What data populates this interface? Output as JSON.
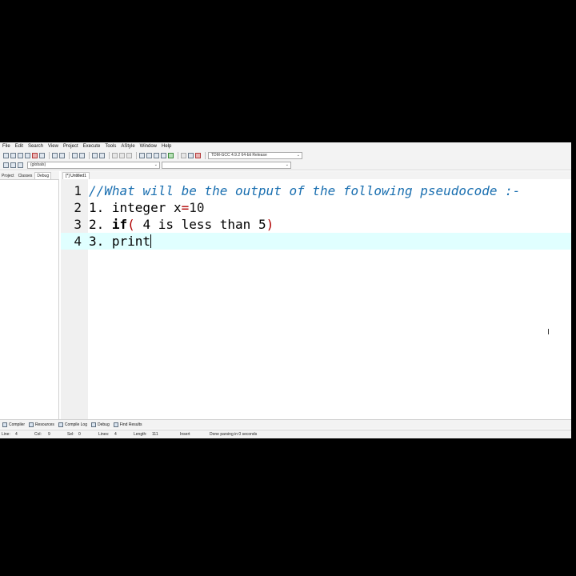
{
  "menu": [
    "File",
    "Edit",
    "Search",
    "View",
    "Project",
    "Execute",
    "Tools",
    "AStyle",
    "Window",
    "Help"
  ],
  "toolbar": {
    "compiler_select": "TDM-GCC 4.9.2 64-bit Release",
    "scope_select": "(globals)",
    "function_select": ""
  },
  "left_panel": {
    "tabs": [
      "Project",
      "Classes",
      "Debug"
    ]
  },
  "editor": {
    "tab_label": "[*] Untitled1",
    "lines": [
      {
        "num": "1",
        "text": "//What will be the output of the following pseudocode :-"
      },
      {
        "num": "2",
        "prefix": "1. integer x",
        "op": "=",
        "value": "10"
      },
      {
        "num": "3",
        "prefix": "2. ",
        "keyword": "if",
        "paren_open": "(",
        "middle": " 4 is less than 5",
        "paren_close": ")"
      },
      {
        "num": "4",
        "text": "3. print"
      }
    ],
    "current_line": 4
  },
  "bottom_tabs": [
    "Compiler",
    "Resources",
    "Compile Log",
    "Debug",
    "Find Results"
  ],
  "status": {
    "line_label": "Line:",
    "line_value": "4",
    "col_label": "Col:",
    "col_value": "9",
    "sel_label": "Sel:",
    "sel_value": "0",
    "lines_label": "Lines:",
    "lines_value": "4",
    "length_label": "Length:",
    "length_value": "111",
    "mode": "Insert",
    "message": "Done parsing in 0 seconds"
  }
}
